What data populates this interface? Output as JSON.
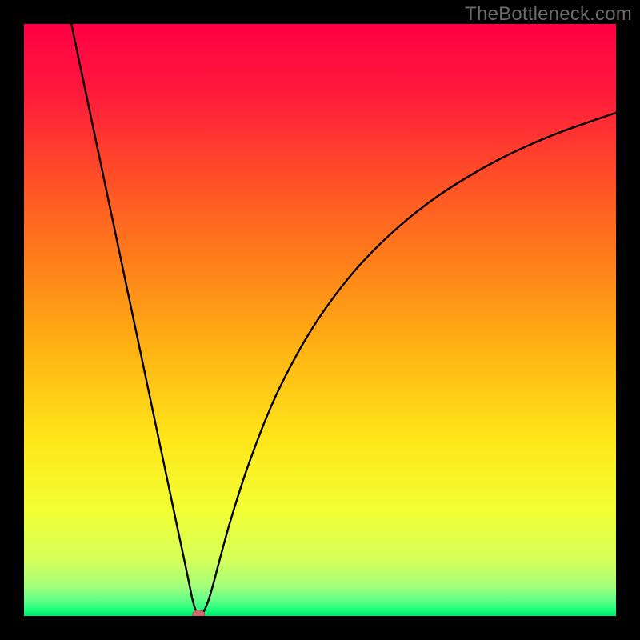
{
  "watermark": "TheBottleneck.com",
  "chart_data": {
    "type": "line",
    "title": "",
    "xlabel": "",
    "ylabel": "",
    "xlim": [
      0,
      100
    ],
    "ylim": [
      0,
      100
    ],
    "grid": false,
    "series": [
      {
        "name": "bottleneck-curve",
        "x": [
          8,
          10,
          12,
          14,
          16,
          18,
          20,
          22,
          24,
          26,
          27,
          28,
          28.5,
          29,
          29.5,
          30,
          31,
          32,
          33,
          35,
          38,
          42,
          46,
          50,
          55,
          60,
          65,
          70,
          75,
          80,
          85,
          90,
          95,
          100
        ],
        "y": [
          100,
          90.5,
          81,
          71.5,
          62,
          52.5,
          43,
          33.5,
          24,
          14.5,
          9.8,
          5,
          2.6,
          1,
          0.3,
          0.2,
          2.2,
          5.5,
          9.3,
          16.5,
          25.8,
          36,
          44,
          50.6,
          57.3,
          62.7,
          67.2,
          71,
          74.2,
          77,
          79.4,
          81.5,
          83.3,
          85
        ]
      }
    ],
    "annotations": [
      {
        "name": "minimum-marker",
        "x": 29.5,
        "y": 0.3,
        "color": "#cd6b6f",
        "shape": "ellipse"
      }
    ],
    "background": {
      "type": "vertical-gradient",
      "stops": [
        {
          "pos": 0.0,
          "color": "#ff0044"
        },
        {
          "pos": 0.12,
          "color": "#ff1b3b"
        },
        {
          "pos": 0.25,
          "color": "#ff4b28"
        },
        {
          "pos": 0.4,
          "color": "#ff7e1a"
        },
        {
          "pos": 0.55,
          "color": "#ffb313"
        },
        {
          "pos": 0.7,
          "color": "#ffe61a"
        },
        {
          "pos": 0.82,
          "color": "#f2ff33"
        },
        {
          "pos": 0.905,
          "color": "#d6ff5a"
        },
        {
          "pos": 0.948,
          "color": "#a6ff7a"
        },
        {
          "pos": 0.972,
          "color": "#66ff88"
        },
        {
          "pos": 0.99,
          "color": "#1aff7a"
        },
        {
          "pos": 1.0,
          "color": "#00e86b"
        }
      ]
    }
  }
}
